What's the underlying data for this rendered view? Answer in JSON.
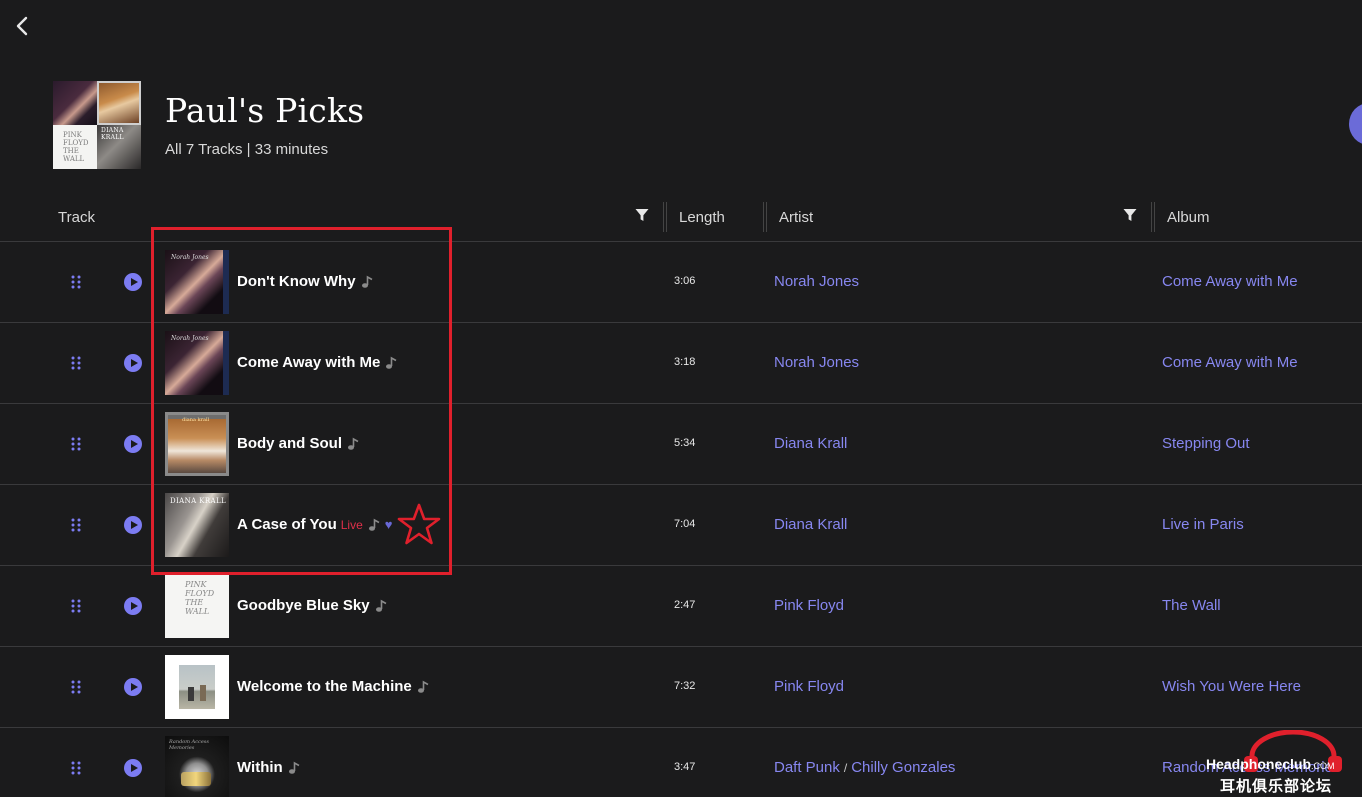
{
  "nav": {
    "back_icon": "chevron-left-icon"
  },
  "playlist": {
    "title": "Paul's Picks",
    "summary": "All 7 Tracks | 33 minutes",
    "mosaic_labels": {
      "t3": "PINK FLOYD THE WALL",
      "t4": "DIANA KRALL"
    }
  },
  "columns": {
    "track": "Track",
    "length": "Length",
    "artist": "Artist",
    "album": "Album"
  },
  "colors": {
    "accent": "#8787f0",
    "live": "#e0304a",
    "highlight": "#e0202c",
    "background": "#1b1b1c"
  },
  "tracks": [
    {
      "name": "Don't Know Why",
      "length": "3:06",
      "artists": [
        "Norah Jones"
      ],
      "album": "Come Away with Me",
      "art": "norah",
      "art_label": "Norah Jones"
    },
    {
      "name": "Come Away with Me",
      "length": "3:18",
      "artists": [
        "Norah Jones"
      ],
      "album": "Come Away with Me",
      "art": "norah",
      "art_label": "Norah Jones"
    },
    {
      "name": "Body and Soul",
      "length": "5:34",
      "artists": [
        "Diana Krall"
      ],
      "album": "Stepping Out",
      "art": "krall1",
      "art_label": "diana krall"
    },
    {
      "name": "A Case of You",
      "live_label": "Live",
      "favorite": true,
      "length": "7:04",
      "artists": [
        "Diana Krall"
      ],
      "album": "Live in Paris",
      "art": "krall2",
      "art_label": "DIANA KRALL"
    },
    {
      "name": "Goodbye Blue Sky",
      "length": "2:47",
      "artists": [
        "Pink Floyd"
      ],
      "album": "The Wall",
      "art": "wall",
      "art_label": "PINK FLOYD THE WALL"
    },
    {
      "name": "Welcome to the Machine",
      "length": "7:32",
      "artists": [
        "Pink Floyd"
      ],
      "album": "Wish You Were Here",
      "art": "wish",
      "art_label": ""
    },
    {
      "name": "Within",
      "length": "3:47",
      "artists": [
        "Daft Punk",
        "Chilly Gonzales"
      ],
      "artist_separator": "/",
      "album": "Random Access Memories",
      "art": "daft",
      "art_label": "Random Access Memories"
    }
  ],
  "watermark": {
    "line1": "Headphoneclub",
    "line1_suffix": ".COM",
    "line2": "耳机俱乐部论坛"
  }
}
